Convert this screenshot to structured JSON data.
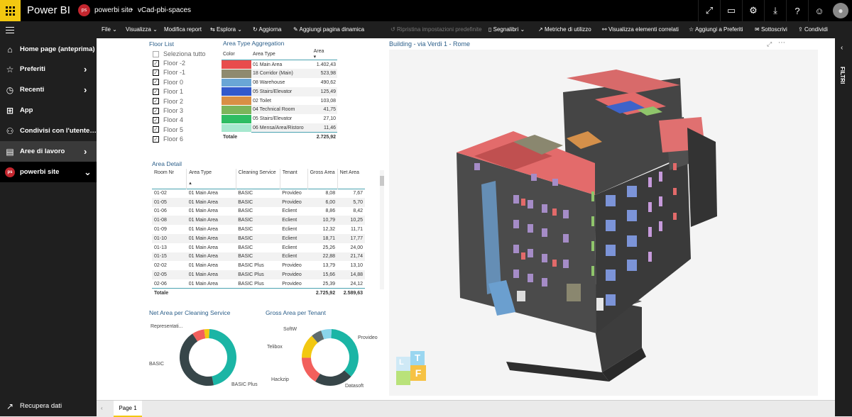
{
  "topbar": {
    "brand": "Power BI",
    "workspace_badge": "ps",
    "workspace_name": "powerbi site",
    "report_name": "vCad-pbi-spaces",
    "icons": [
      "expand-icon",
      "comment-icon",
      "settings-icon",
      "download-icon",
      "help-icon",
      "feedback-icon"
    ]
  },
  "sidebar": {
    "items": [
      {
        "label": "Home page (anteprima)",
        "icon": "home-icon"
      },
      {
        "label": "Preferiti",
        "icon": "star-icon"
      },
      {
        "label": "Recenti",
        "icon": "clock-icon"
      },
      {
        "label": "App",
        "icon": "apps-icon"
      },
      {
        "label": "Condivisi con l'utente co...",
        "icon": "share-icon"
      },
      {
        "label": "Aree di lavoro",
        "icon": "workspaces-icon"
      },
      {
        "label": "powerbi site",
        "badge": "ps"
      }
    ],
    "get_data": "Recupera dati"
  },
  "toolbar": {
    "file": "File",
    "view": "Visualizza",
    "edit": "Modifica report",
    "explore": "Esplora",
    "refresh": "Aggiorna",
    "add_dynamic": "Aggiungi pagina dinamica",
    "reset": "Ripristina impostazioni predefinite",
    "bookmarks": "Segnalibri",
    "usage": "Metriche di utilizzo",
    "related": "Visualizza elementi correlati",
    "favorites": "Aggiungi a Preferiti",
    "subscribe": "Sottoscrivi",
    "share": "Condividi"
  },
  "floor_list": {
    "title": "Floor List",
    "select_all": "Seleziona tutto",
    "floors": [
      "Floor -2",
      "Floor -1",
      "Floor 0",
      "Floor 1",
      "Floor 2",
      "Floor 3",
      "Floor 4",
      "Floor 5",
      "Floor 6"
    ]
  },
  "area_agg": {
    "title": "Area Type Aggregation",
    "headers": {
      "color": "Color",
      "type": "Area Type",
      "area": "Area"
    },
    "rows": [
      {
        "type": "01 Main Area",
        "area": "1.402,43",
        "color": "#e84c4c"
      },
      {
        "type": "18 Corridor (Main)",
        "area": "523,98",
        "color": "#8f8a6f"
      },
      {
        "type": "08 Warehouse",
        "area": "490,62",
        "color": "#6aa6d6"
      },
      {
        "type": "05 Stairs/Elevator",
        "area": "125,49",
        "color": "#3359cc"
      },
      {
        "type": "02 Toilet",
        "area": "103,08",
        "color": "#d98f45"
      },
      {
        "type": "04 Technical Room",
        "area": "41,75",
        "color": "#7cb55b"
      },
      {
        "type": "05 Stairs/Elevator",
        "area": "27,10",
        "color": "#2ebd63"
      },
      {
        "type": "06 Mensa/Area/Ristoro",
        "area": "11,46",
        "color": "#a7e8cf"
      }
    ],
    "total_label": "Totale",
    "total": "2.725,92"
  },
  "area_detail": {
    "title": "Area Detail",
    "headers": [
      "Room Nr",
      "Area Type",
      "Cleaning Service",
      "Tenant",
      "Gross Area",
      "Net Area"
    ],
    "rows": [
      [
        "01-02",
        "01 Main Area",
        "BASIC",
        "Provideo",
        "8,08",
        "7,67"
      ],
      [
        "01-05",
        "01 Main Area",
        "BASIC",
        "Provideo",
        "6,00",
        "5,70"
      ],
      [
        "01-06",
        "01 Main Area",
        "BASIC",
        "Eclient",
        "8,86",
        "8,42"
      ],
      [
        "01-08",
        "01 Main Area",
        "BASIC",
        "Eclient",
        "10,79",
        "10,25"
      ],
      [
        "01-09",
        "01 Main Area",
        "BASIC",
        "Eclient",
        "12,32",
        "11,71"
      ],
      [
        "01-10",
        "01 Main Area",
        "BASIC",
        "Eclient",
        "18,71",
        "17,77"
      ],
      [
        "01-13",
        "01 Main Area",
        "BASIC",
        "Eclient",
        "25,26",
        "24,00"
      ],
      [
        "01-15",
        "01 Main Area",
        "BASIC",
        "Eclient",
        "22,88",
        "21,74"
      ],
      [
        "02-02",
        "01 Main Area",
        "BASIC Plus",
        "Provideo",
        "13,79",
        "13,10"
      ],
      [
        "02-05",
        "01 Main Area",
        "BASIC Plus",
        "Provideo",
        "15,66",
        "14,88"
      ],
      [
        "02-06",
        "01 Main Area",
        "BASIC Plus",
        "Provideo",
        "25,39",
        "24,12"
      ]
    ],
    "total_label": "Totale",
    "total_gross": "2.725,92",
    "total_net": "2.589,63"
  },
  "chart_data": [
    {
      "type": "pie",
      "title": "Net Area per Cleaning Service",
      "categories": [
        "BASIC Plus",
        "BASIC",
        "Representati...",
        "other"
      ],
      "values": [
        46,
        44,
        7,
        3
      ],
      "colors": [
        "#1bb5a5",
        "#374649",
        "#f25f5c",
        "#f2c811"
      ]
    },
    {
      "type": "pie",
      "title": "Gross Area per Tenant",
      "categories": [
        "Provideo",
        "Datasoft",
        "Hackzip",
        "Telibox",
        "SoftW",
        "other"
      ],
      "values": [
        36,
        22,
        16,
        14,
        6,
        6
      ],
      "colors": [
        "#1bb5a5",
        "#374649",
        "#f25f5c",
        "#f2c811",
        "#5f6b6d",
        "#8ad4eb"
      ]
    }
  ],
  "model": {
    "title": "Building - via Verdi 1 - Rome",
    "logo_text": "LTF"
  },
  "right_panel": {
    "filters": "FILTRI"
  },
  "pages": {
    "tab": "Page 1"
  }
}
